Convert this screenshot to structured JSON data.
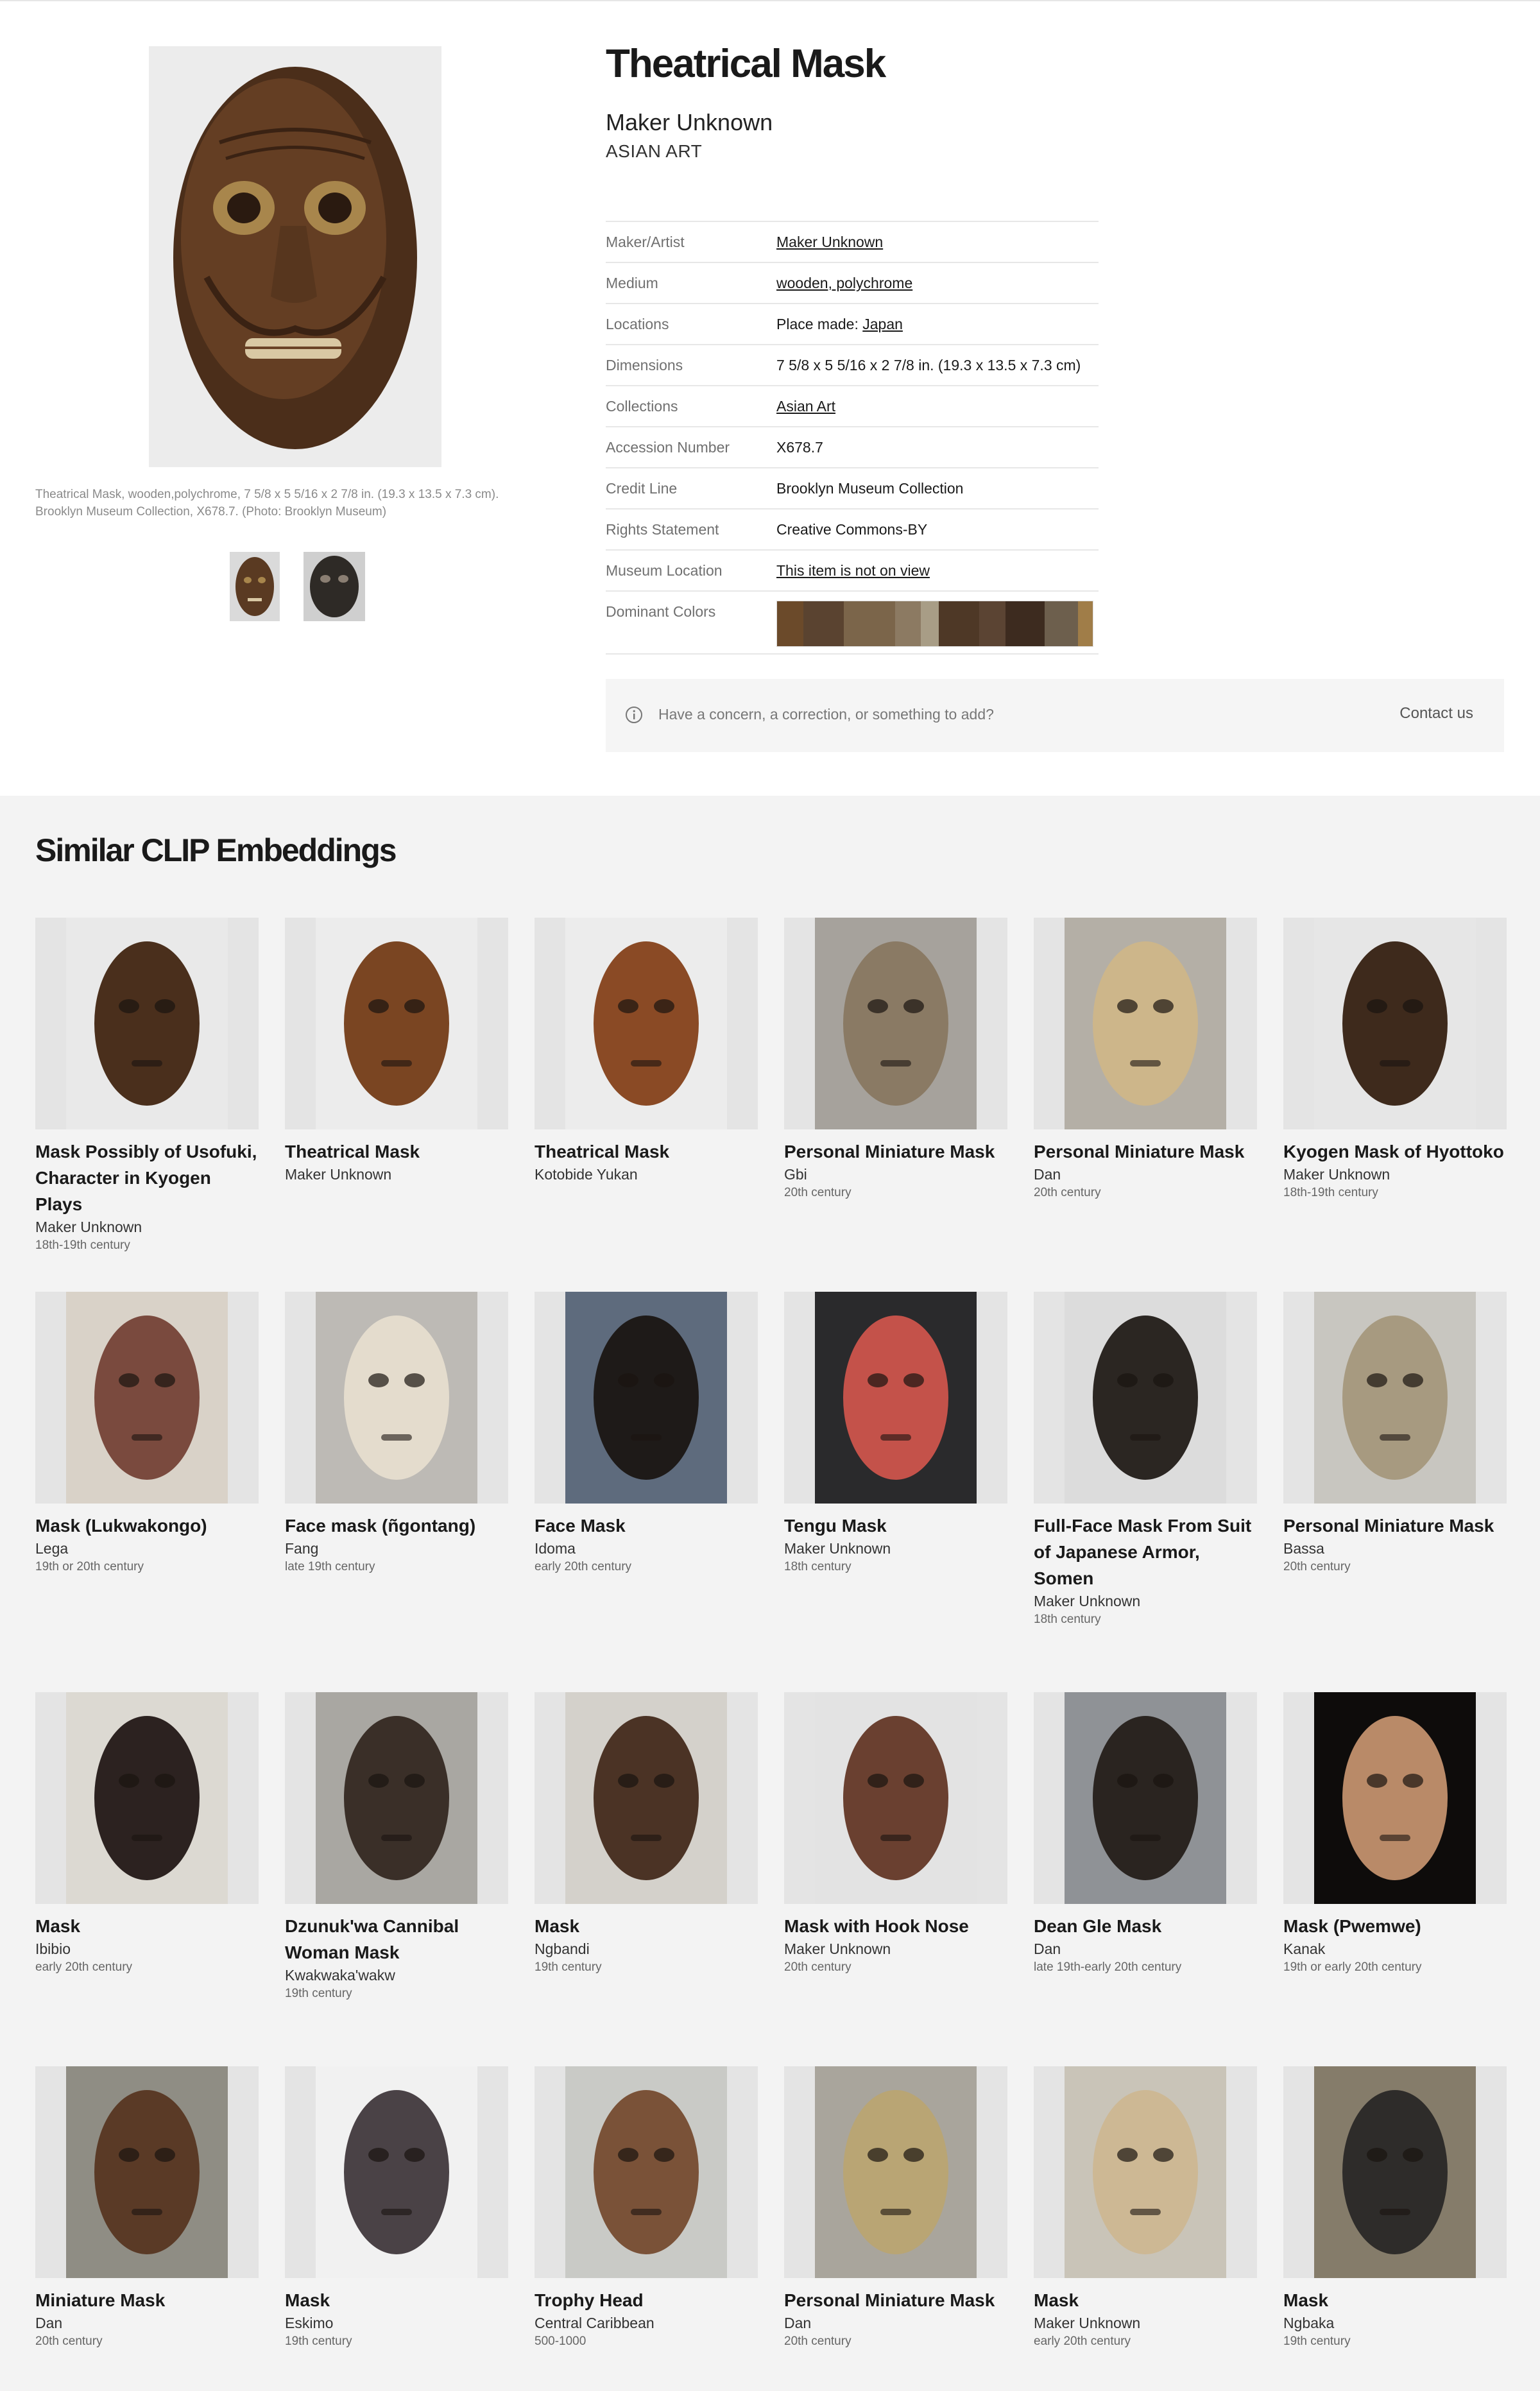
{
  "object": {
    "title": "Theatrical Mask",
    "maker": "Maker Unknown",
    "department": "ASIAN ART",
    "caption": "Theatrical Mask, wooden,polychrome, 7 5/8 x 5 5/16 x 2 7/8 in. (19.3 x 13.5 x 7.3 cm). Brooklyn Museum Collection, X678.7. (Photo: Brooklyn Museum)"
  },
  "facts": {
    "maker_label": "Maker/Artist",
    "maker_value": "Maker Unknown",
    "medium_label": "Medium",
    "medium_value": "wooden, polychrome",
    "locations_label": "Locations",
    "locations_prefix": "Place made: ",
    "locations_value": "Japan",
    "dimensions_label": "Dimensions",
    "dimensions_value": "7 5/8 x 5 5/16 x 2 7/8 in. (19.3 x 13.5 x 7.3 cm)",
    "collections_label": "Collections",
    "collections_value": "Asian Art",
    "accession_label": "Accession Number",
    "accession_value": "X678.7",
    "credit_label": "Credit Line",
    "credit_value": "Brooklyn Museum Collection",
    "rights_label": "Rights Statement",
    "rights_value": "Creative Commons-BY",
    "location_label": "Museum Location",
    "location_value": "This item is not on view",
    "colors_label": "Dominant Colors"
  },
  "dominant_colors": [
    "#6b4a2a",
    "#5a4330",
    "#7b654a",
    "#8c7a62",
    "#a89d86",
    "#4e3826",
    "#5b4433",
    "#3d2b1f",
    "#6d5f4d",
    "#a07d48"
  ],
  "concern": {
    "text": "Have a concern, a correction, or something to add?",
    "contact": "Contact us",
    "icon": "info-icon"
  },
  "similar": {
    "heading": "Similar CLIP Embeddings",
    "items": [
      {
        "title": "Mask Possibly of Usofuki, Character in Kyogen Plays",
        "maker": "Maker Unknown",
        "date": "18th-19th century",
        "bg": "#e4e4e4",
        "panel": "#e9e9e9",
        "mask": "#4a2f1c"
      },
      {
        "title": "Theatrical Mask",
        "maker": "Maker Unknown",
        "date": "",
        "bg": "#e4e4e4",
        "panel": "#ececec",
        "mask": "#7a4522"
      },
      {
        "title": "Theatrical Mask",
        "maker": "Kotobide Yukan",
        "date": "",
        "bg": "#e4e4e4",
        "panel": "#ececec",
        "mask": "#8a4a25"
      },
      {
        "title": "Personal Miniature Mask",
        "maker": "Gbi",
        "date": "20th century",
        "bg": "#e4e4e4",
        "panel": "#a6a29c",
        "mask": "#8a7a64"
      },
      {
        "title": "Personal Miniature Mask",
        "maker": "Dan",
        "date": "20th century",
        "bg": "#e4e4e4",
        "panel": "#b4afa6",
        "mask": "#cdb68a"
      },
      {
        "title": "Kyogen Mask of Hyottoko",
        "maker": "Maker Unknown",
        "date": "18th-19th century",
        "bg": "#e4e4e4",
        "panel": "#e6e6e6",
        "mask": "#3e2a1c"
      },
      {
        "title": "Mask (Lukwakongo)",
        "maker": "Lega",
        "date": "19th or 20th century",
        "bg": "#e4e4e4",
        "panel": "#d9d2c8",
        "mask": "#7a4a3e"
      },
      {
        "title": "Face mask (ñgontang)",
        "maker": "Fang",
        "date": "late 19th century",
        "bg": "#e4e4e4",
        "panel": "#bdbab5",
        "mask": "#e4dccd"
      },
      {
        "title": "Face Mask",
        "maker": "Idoma",
        "date": "early 20th century",
        "bg": "#e4e4e4",
        "panel": "#5e6b7d",
        "mask": "#1e1a18"
      },
      {
        "title": "Tengu Mask",
        "maker": "Maker Unknown",
        "date": "18th century",
        "bg": "#e4e4e4",
        "panel": "#2a2a2c",
        "mask": "#c4524a"
      },
      {
        "title": "Full-Face Mask From Suit of Japanese Armor, Somen",
        "maker": "Maker Unknown",
        "date": "18th century",
        "bg": "#e4e4e4",
        "panel": "#dcdcdc",
        "mask": "#2b2622"
      },
      {
        "title": "Personal Miniature Mask",
        "maker": "Bassa",
        "date": "20th century",
        "bg": "#e4e4e4",
        "panel": "#c8c6c0",
        "mask": "#a79a80"
      },
      {
        "title": "Mask",
        "maker": "Ibibio",
        "date": "early 20th century",
        "bg": "#e4e4e4",
        "panel": "#dcd9d2",
        "mask": "#2c2220"
      },
      {
        "title": "Dzunuk'wa Cannibal Woman Mask",
        "maker": "Kwakwaka'wakw",
        "date": "19th century",
        "bg": "#e4e4e4",
        "panel": "#a9a7a2",
        "mask": "#3a2f28"
      },
      {
        "title": "Mask",
        "maker": "Ngbandi",
        "date": "19th century",
        "bg": "#e4e4e4",
        "panel": "#d4d1cb",
        "mask": "#4b3325"
      },
      {
        "title": "Mask with Hook Nose",
        "maker": "Maker Unknown",
        "date": "20th century",
        "bg": "#e4e4e4",
        "panel": "#e3e3e3",
        "mask": "#6a4030"
      },
      {
        "title": "Dean Gle Mask",
        "maker": "Dan",
        "date": "late 19th-early 20th century",
        "bg": "#e4e4e4",
        "panel": "#8f9296",
        "mask": "#2a2420"
      },
      {
        "title": "Mask (Pwemwe)",
        "maker": "Kanak",
        "date": "19th or early 20th century",
        "bg": "#e4e4e4",
        "panel": "#0e0c0b",
        "mask": "#b98a68"
      },
      {
        "title": "Miniature Mask",
        "maker": "Dan",
        "date": "20th century",
        "bg": "#e4e4e4",
        "panel": "#8f8d84",
        "mask": "#5a3a26"
      },
      {
        "title": "Mask",
        "maker": "Eskimo",
        "date": "19th century",
        "bg": "#e4e4e4",
        "panel": "#f1f1f1",
        "mask": "#4a4246"
      },
      {
        "title": "Trophy Head",
        "maker": "Central Caribbean",
        "date": "500-1000",
        "bg": "#e4e4e4",
        "panel": "#c9cac6",
        "mask": "#7a5238"
      },
      {
        "title": "Personal Miniature Mask",
        "maker": "Dan",
        "date": "20th century",
        "bg": "#e4e4e4",
        "panel": "#a9a59c",
        "mask": "#b9a574"
      },
      {
        "title": "Mask",
        "maker": "Maker Unknown",
        "date": "early 20th century",
        "bg": "#e4e4e4",
        "panel": "#c9c4b8",
        "mask": "#cdb894"
      },
      {
        "title": "Mask",
        "maker": "Ngbaka",
        "date": "19th century",
        "bg": "#e4e4e4",
        "panel": "#857c6a",
        "mask": "#2e2c2a"
      }
    ]
  }
}
